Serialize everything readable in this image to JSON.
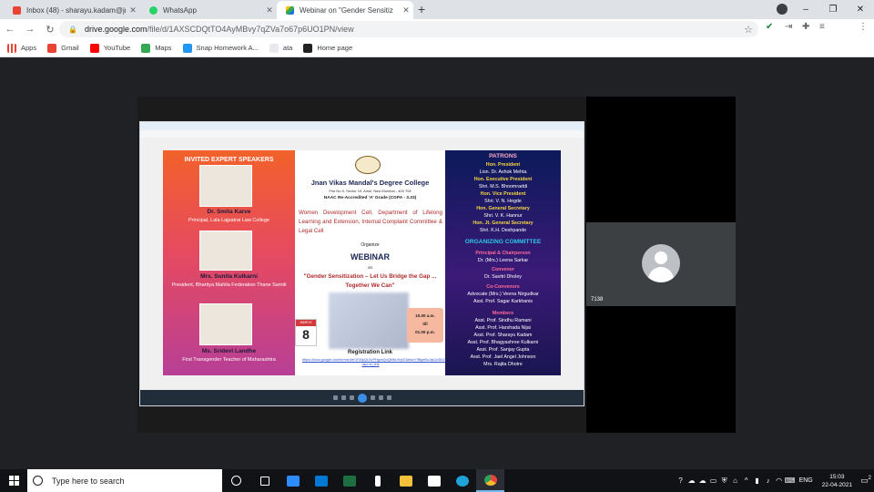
{
  "browser": {
    "tabs": [
      {
        "title": "Inbox (48) - sharayu.kadam@jna",
        "icon": "gmail-icon",
        "color": "#ea4335"
      },
      {
        "title": "WhatsApp",
        "icon": "whatsapp-icon",
        "color": "#25d366"
      },
      {
        "title": "Webinar on \"Gender Sensitiz",
        "icon": "drive-icon",
        "color": "#1a73e8"
      }
    ],
    "new_tab": "+",
    "address": {
      "domain": "drive.google.com",
      "path": "/file/d/1AXSCDQtTO4AyMBvy7qZVa7o67p6UO1PN/view"
    },
    "profile_initial": "s",
    "bookmarks": [
      {
        "label": "Apps",
        "color": "#ea4335"
      },
      {
        "label": "Gmail",
        "color": "#ea4335"
      },
      {
        "label": "YouTube",
        "color": "#ff0000"
      },
      {
        "label": "Maps",
        "color": "#34a853"
      },
      {
        "label": "Snap Homework A...",
        "color": "#2196f3"
      },
      {
        "label": "ata",
        "color": "#e8eaed"
      },
      {
        "label": "Home page",
        "color": "#222"
      }
    ]
  },
  "meeting": {
    "participant_label": "7138"
  },
  "poster": {
    "speakers_heading": "INVITED EXPERT SPEAKERS",
    "speakers": [
      {
        "name": "Dr. Smita Karve",
        "desc": "Principal, Lala Lajpatrai Law College"
      },
      {
        "name": "Mrs. Sunita Kulkarni",
        "desc": "President, Bhartiya Mahila Federation Thane Samiti"
      },
      {
        "name": "Ms. Sridevi Landhe",
        "desc": "First Transgender Teacher of Maharashtra"
      }
    ],
    "college": "Jnan Vikas Mandal's Degree College",
    "address": "Plot No.9, Sector 19, Airoli, Navi Mumbai - 400 708",
    "naac": "NAAC Re-Accredited 'A' Grade (CGPA - 3.33)",
    "departments": "Women Development Cell, Department of Lifelong Learning and Extension, Internal Complaint Committee & Legal Cell",
    "organize": "Organize",
    "event": "WEBINAR",
    "on": "on",
    "topic": "\"Gender Sensitization – Let Us Bridge the Gap ... Together We Can\"",
    "month": "MARCH",
    "day": "8",
    "time_from": "10.00 a.m.",
    "time_till": "till",
    "time_to": "01.00 p.m.",
    "registration": "Registration Link",
    "link": "https://docs.google.com/forms/d/e/1FAIpQLScPHgvsQuQMbLiVqrC8AlsoY9BgeBuJqs1z3810KT/viewform?usp=sf_link",
    "patrons_heading": "PATRONS",
    "patrons": [
      {
        "role": "Hon. President",
        "name": "Lion. Dr. Ashok Mehta"
      },
      {
        "role": "Hon. Executive President",
        "name": "Shri. M.S. Bhoomraddi"
      },
      {
        "role": "Hon. Vice President",
        "name": "Shri. V. N. Hegde"
      },
      {
        "role": "Hon. General Secretary",
        "name": "Shri. V. K. Hannur"
      },
      {
        "role": "Hon. Jt. General Secretary",
        "name": "Shri. K.H. Deshpande"
      }
    ],
    "committee_heading": "ORGANIZING COMMITTEE",
    "committee": [
      {
        "role": "Principal & Chairperson",
        "names": [
          "Dr. (Mrs.) Leena Sarkar"
        ]
      },
      {
        "role": "Convenor",
        "names": [
          "Dr. Savitri Dholey"
        ]
      },
      {
        "role": "Co-Convenors",
        "names": [
          "Advocate (Mrs.) Veena Nirgudkar",
          "Asst. Prof. Sagar Karkhanis"
        ]
      },
      {
        "role": "Members",
        "names": [
          "Asst. Prof. Sindhu Ramani",
          "Asst. Prof. Harshada Nijai",
          "Asst. Prof. Sharayu Kadam",
          "Asst. Prof. Bhagyashree Kulkarni",
          "Asst. Prof. Sanjay Gupta",
          "Asst. Prof. Jael Angel Johnson",
          "Mrs. Rajita Dhotre"
        ]
      }
    ]
  },
  "taskbar": {
    "search_placeholder": "Type here to search",
    "apps": [
      {
        "name": "cortana-icon",
        "color": "#ffffff"
      },
      {
        "name": "task-view-icon",
        "color": "#ffffff"
      },
      {
        "name": "zoom-icon",
        "color": "#2d8cff"
      },
      {
        "name": "mail-icon",
        "color": "#0078d4"
      },
      {
        "name": "excel-icon",
        "color": "#1d6f42"
      },
      {
        "name": "s-app-icon",
        "color": "#ffffff"
      },
      {
        "name": "file-explorer-icon",
        "color": "#f3c13a"
      },
      {
        "name": "amazon-icon",
        "color": "#ffffff"
      },
      {
        "name": "edge-icon",
        "color": "#1ea2d8"
      },
      {
        "name": "chrome-icon",
        "color": "#e8453c"
      }
    ],
    "language": "ENG",
    "time": "15:03",
    "date": "22-04-2021",
    "notifications": "2"
  }
}
